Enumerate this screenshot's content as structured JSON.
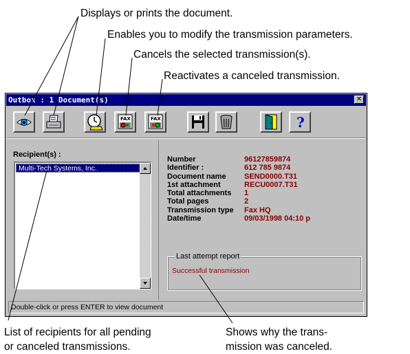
{
  "callouts": {
    "displays": "Displays or prints the document.",
    "modify": "Enables you to modify the transmission parameters.",
    "cancel": "Cancels the selected transmission(s).",
    "reactivate": "Reactivates a canceled transmission.",
    "list_line1": "List of recipients for all pending",
    "list_line2": "or canceled transmissions.",
    "shows_line1": "Shows why the trans-",
    "shows_line2": "mission was canceled."
  },
  "window": {
    "title": "Outbox : 1 Document(s)",
    "close_glyph": "✕"
  },
  "toolbar": {
    "buttons": [
      {
        "icon": "eye-icon"
      },
      {
        "icon": "printer-icon"
      },
      {
        "icon": "clock-phone-icon"
      },
      {
        "icon": "fax-cancel-icon"
      },
      {
        "icon": "fax-reactivate-icon"
      },
      {
        "icon": "floppy-disk-icon"
      },
      {
        "icon": "trash-can-icon"
      },
      {
        "icon": "exit-door-icon"
      },
      {
        "icon": "help-icon"
      }
    ],
    "help_glyph": "?",
    "fax_text": "FAX"
  },
  "recipients": {
    "label": "Recipient(s) :",
    "items": [
      "Multi-Tech Systems, Inc."
    ]
  },
  "details": [
    {
      "label": "Number",
      "value": "96127859874"
    },
    {
      "label": "Identifier :",
      "value": "612 785 9874"
    },
    {
      "label": "Document name",
      "value": "SEND0000.T31"
    },
    {
      "label": "1st attachment",
      "value": "RECU0007.T31"
    },
    {
      "label": "Total attachments",
      "value": "1"
    },
    {
      "label": "Total pages",
      "value": "2"
    },
    {
      "label": "Transmission type",
      "value": "Fax HQ"
    },
    {
      "label": "Date/time",
      "value": "09/03/1998 04:10 p"
    }
  ],
  "report": {
    "title": "Last attempt report",
    "text": "Successful transmission"
  },
  "status": "Double-click or press ENTER to view document",
  "colors": {
    "titlebar": "#000080",
    "window_face": "#c0c0c0",
    "value_text": "#8b0000"
  }
}
